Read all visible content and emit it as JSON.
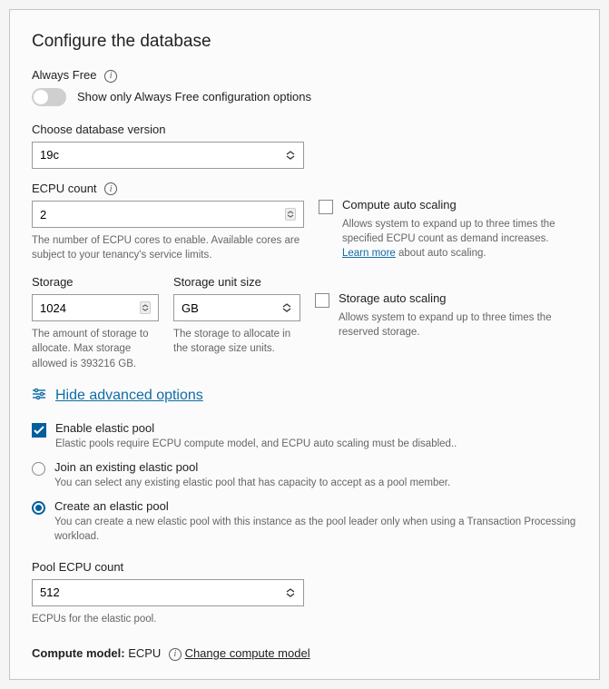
{
  "title": "Configure the database",
  "always_free": {
    "label": "Always Free",
    "toggle_text": "Show only Always Free configuration options"
  },
  "db_version": {
    "label": "Choose database version",
    "value": "19c"
  },
  "ecpu": {
    "label": "ECPU count",
    "value": "2",
    "helper": "The number of ECPU cores to enable. Available cores are subject to your tenancy's service limits."
  },
  "compute_auto": {
    "label": "Compute auto scaling",
    "helper_pre": "Allows system to expand up to three times the specified ECPU count as demand increases. ",
    "learn_more": "Learn more",
    "helper_post": " about auto scaling."
  },
  "storage": {
    "label": "Storage",
    "value": "1024",
    "helper": "The amount of storage to allocate. Max storage allowed is 393216 GB."
  },
  "storage_unit": {
    "label": "Storage unit size",
    "value": "GB",
    "helper": "The storage to allocate in the storage size units."
  },
  "storage_auto": {
    "label": "Storage auto scaling",
    "helper": "Allows system to expand up to three times the reserved storage."
  },
  "advanced_toggle": "Hide advanced options",
  "elastic_pool": {
    "enable_label": "Enable elastic pool",
    "enable_helper": "Elastic pools require ECPU compute model, and ECPU auto scaling must be disabled..",
    "join_label": "Join an existing elastic pool",
    "join_helper": "You can select any existing elastic pool that has capacity to accept as a pool member.",
    "create_label": "Create an elastic pool",
    "create_helper": "You can create a new elastic pool with this instance as the pool leader only when using a Transaction Processing workload."
  },
  "pool_ecpu": {
    "label": "Pool ECPU count",
    "value": "512",
    "helper": "ECPUs for the elastic pool."
  },
  "compute_model": {
    "prefix": "Compute model:",
    "value": "ECPU",
    "change_link": "Change compute model"
  }
}
